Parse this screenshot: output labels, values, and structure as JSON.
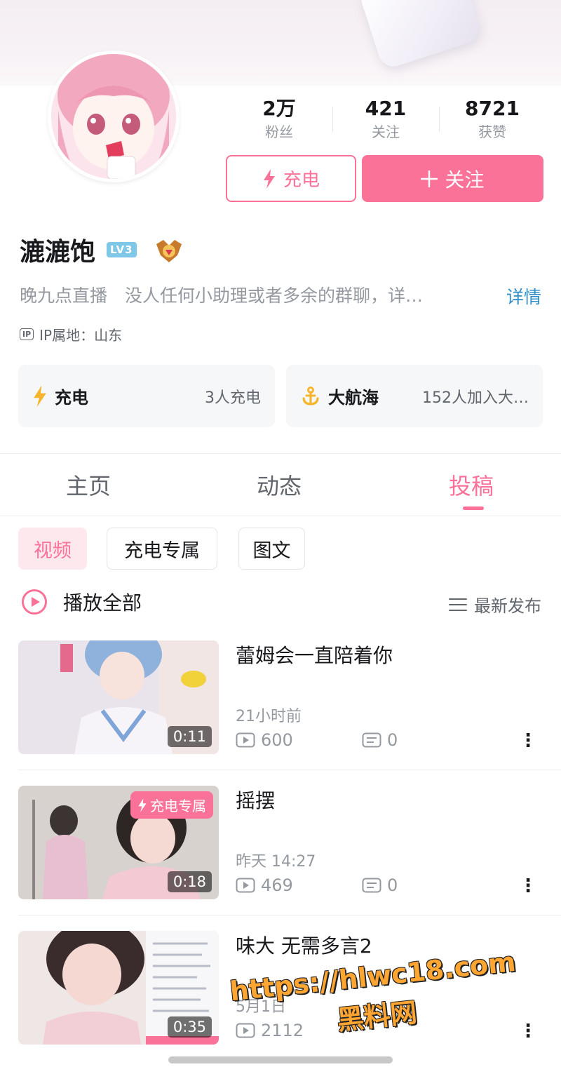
{
  "profile": {
    "stats": [
      {
        "value": "2万",
        "label": "粉丝"
      },
      {
        "value": "421",
        "label": "关注"
      },
      {
        "value": "8721",
        "label": "获赞"
      }
    ],
    "charge_button": "充电",
    "follow_button": "关注",
    "username": "漉漉饱",
    "level_badge": "LV3",
    "bio": "晚九点直播　没人任何小助理或者多余的群聊，详…",
    "detail_link": "详情",
    "ip_badge": "IP",
    "ip_location": "IP属地：山东"
  },
  "cards": {
    "charge": {
      "title": "充电",
      "subtitle": "3人充电"
    },
    "voyage": {
      "title": "大航海",
      "subtitle": "152人加入大…"
    }
  },
  "tabs": [
    "主页",
    "动态",
    "投稿"
  ],
  "active_tab": "投稿",
  "filters": [
    "视频",
    "充电专属",
    "图文"
  ],
  "active_filter": "视频",
  "list_header": {
    "play_all": "播放全部",
    "sort": "最新发布"
  },
  "videos": [
    {
      "title": "蕾姆会一直陪着你",
      "time": "21小时前",
      "views": "600",
      "comments": "0",
      "duration": "0:11",
      "tag": ""
    },
    {
      "title": "摇摆",
      "time": "昨天 14:27",
      "views": "469",
      "comments": "0",
      "duration": "0:18",
      "tag": "充电专属"
    },
    {
      "title": "味大 无需多言2",
      "time": "5月1日",
      "views": "2112",
      "comments": "",
      "duration": "0:35",
      "tag": ""
    }
  ],
  "watermark": {
    "url": "https://hlwc18.com",
    "name": "黑料网"
  },
  "colors": {
    "accent": "#fb7299",
    "link": "#2f8ec9",
    "muted": "#9499a0",
    "level": "#7fc7e6"
  },
  "icons": [
    "lightning-icon",
    "plus-icon",
    "ip-icon",
    "anchor-icon",
    "play-circle-icon",
    "sort-icon",
    "play-count-icon",
    "comment-icon",
    "more-icon",
    "medal-icon"
  ]
}
